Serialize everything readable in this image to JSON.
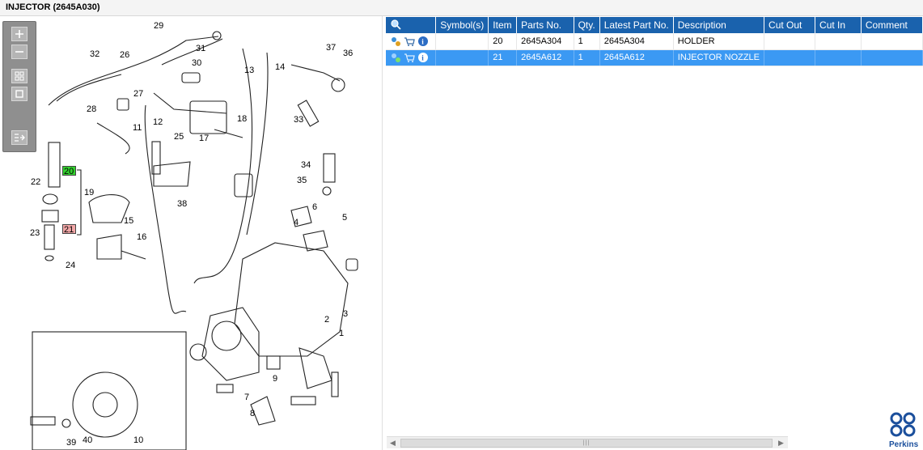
{
  "window": {
    "title": "INJECTOR (2645A030)"
  },
  "toolbar": {
    "buttons": [
      {
        "name": "zoom-in-icon"
      },
      {
        "name": "zoom-out-icon"
      },
      {
        "name": "fit-all-icon"
      },
      {
        "name": "actual-size-icon"
      },
      {
        "name": "export-icon"
      }
    ]
  },
  "diagram": {
    "labels": [
      "29",
      "32",
      "26",
      "31",
      "30",
      "27",
      "28",
      "11",
      "12",
      "25",
      "17",
      "18",
      "13",
      "14",
      "37",
      "36",
      "33",
      "34",
      "35",
      "22",
      "19",
      "38",
      "23",
      "24",
      "15",
      "16",
      "6",
      "4",
      "5",
      "3",
      "2",
      "1",
      "9",
      "7",
      "8",
      "10",
      "39",
      "40"
    ],
    "highlight_green": "20",
    "highlight_red": "21"
  },
  "parts_table": {
    "columns": [
      "",
      "Symbol(s)",
      "Item",
      "Parts No.",
      "Qty.",
      "Latest Part No.",
      "Description",
      "Cut Out",
      "Cut In",
      "Comment"
    ],
    "rows": [
      {
        "item": "20",
        "part_no": "2645A304",
        "qty": "1",
        "latest_part_no": "2645A304",
        "description": "HOLDER",
        "cut_out": "",
        "cut_in": "",
        "comment": "",
        "selected": false
      },
      {
        "item": "21",
        "part_no": "2645A612",
        "qty": "1",
        "latest_part_no": "2645A612",
        "description": "INJECTOR NOZZLE",
        "cut_out": "",
        "cut_in": "",
        "comment": "",
        "selected": true
      }
    ]
  },
  "brand": {
    "name": "Perkins",
    "color": "#1b4f9c"
  },
  "colors": {
    "header": "#1a62ad",
    "selected_row": "#3b99f3",
    "highlight_green": "#33d12e",
    "highlight_red": "#f2a7a7"
  }
}
